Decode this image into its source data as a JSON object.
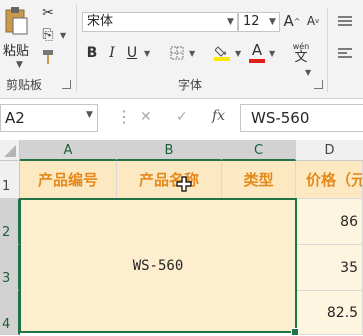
{
  "ribbon": {
    "clipboard": {
      "paste_label": "粘贴",
      "group_label": "剪贴板"
    },
    "font": {
      "font_name": "宋体",
      "font_size": "12",
      "bold": "B",
      "italic": "I",
      "underline": "U",
      "grow": "A",
      "shrink": "A",
      "font_color_letter": "A",
      "wen_label": "wén",
      "wen_char": "文",
      "group_label": "字体",
      "highlight_color": "#ffe600",
      "font_color": "#e51c1c"
    }
  },
  "formula_bar": {
    "name_box": "A2",
    "fx": "fx",
    "value": "WS-560"
  },
  "columns": [
    "A",
    "B",
    "C",
    "D"
  ],
  "rows": [
    "1",
    "2",
    "3",
    "4"
  ],
  "header_row": [
    "产品编号",
    "产品名称",
    "类型",
    "价格（元"
  ],
  "merged_cell_value": "WS-560",
  "price_values": [
    "86",
    "35",
    "82.5"
  ],
  "colors": {
    "accent": "#217346",
    "header_fill": "#fde9c1",
    "header_text": "#e48a1d"
  }
}
